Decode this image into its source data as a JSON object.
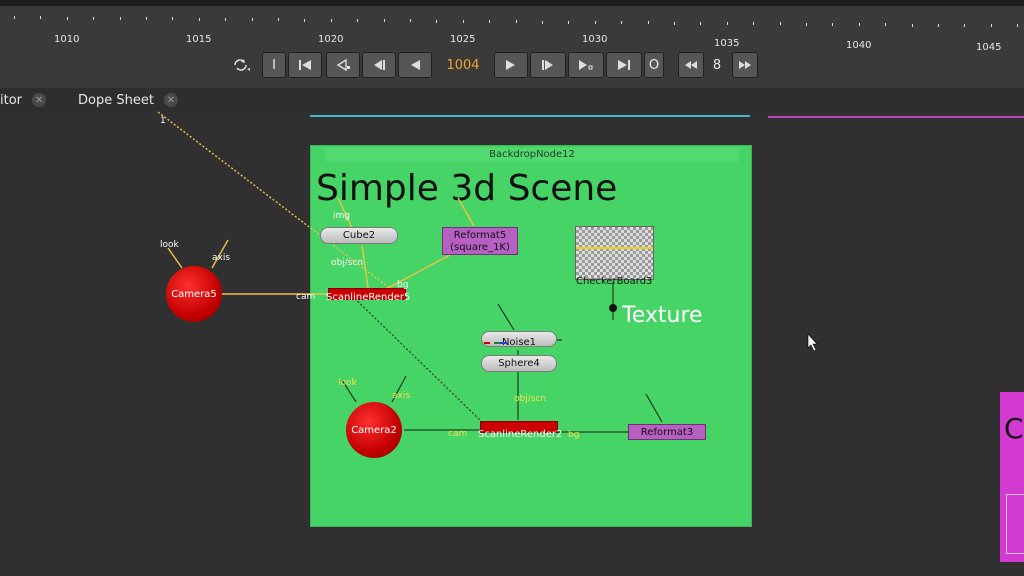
{
  "timeline": {
    "frame_labels": [
      "1010",
      "1015",
      "1020",
      "1025",
      "1030",
      "1035",
      "1040",
      "1045"
    ],
    "current_frame": "1004",
    "step_value": "8",
    "buttons": {
      "in_point": "I",
      "out_point": "O"
    }
  },
  "tabs": [
    {
      "label": "itor",
      "close": "✕"
    },
    {
      "label": "Dope Sheet",
      "close": "✕"
    }
  ],
  "graph": {
    "backdrop": {
      "name": "BackdropNode12",
      "title": "Simple 3d Scene"
    },
    "nodes": {
      "cube": "Cube2",
      "reformat5": "Reformat5",
      "reformat5_sub": "(square_1K)",
      "checkerboard": "CheckerBoard3",
      "texture": "Texture",
      "scanline5": "ScanlineRender5",
      "noise": "Noise1",
      "sphere": "Sphere4",
      "camera5": "Camera5",
      "camera2": "Camera2",
      "scanline2": "ScanlineRender2",
      "reformat3": "Reformat3"
    },
    "inputs": {
      "img": "img",
      "obj_scn_a": "obj/scn",
      "bg_a": "bg",
      "cam_a": "cam",
      "look_a": "look",
      "axis_a": "axis",
      "look_b": "look",
      "axis_b": "axis",
      "obj_scn_b": "obj/scn",
      "cam_b": "cam",
      "bg_b": "bg",
      "pipe_marker": "1"
    },
    "right_panel_letter": "C"
  },
  "colors": {
    "backdrop": "#47d466",
    "render_node": "#cc0000",
    "reformat_node": "#b85fc4",
    "camera": "#d40000",
    "current_frame": "#f0a030",
    "pipe": "#f2c14a"
  }
}
